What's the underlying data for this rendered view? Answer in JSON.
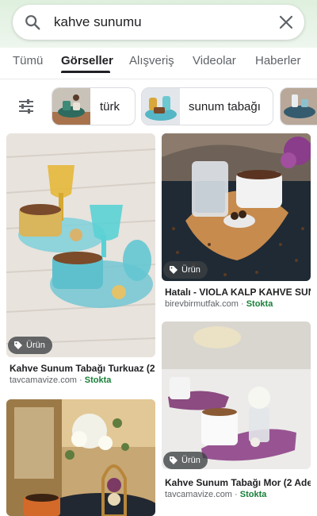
{
  "search": {
    "query": "kahve sunumu",
    "icons": {
      "search": "search-icon",
      "clear": "close-icon"
    }
  },
  "tabs": [
    {
      "label": "Tümü",
      "active": false
    },
    {
      "label": "Görseller",
      "active": true
    },
    {
      "label": "Alışveriş",
      "active": false
    },
    {
      "label": "Videolar",
      "active": false
    },
    {
      "label": "Haberler",
      "active": false
    }
  ],
  "chips": [
    {
      "label": "türk"
    },
    {
      "label": "sunum tabağı"
    }
  ],
  "results": [
    {
      "badge": "Ürün",
      "title": "Kahve Sunum Tabağı Turkuaz (2 ...",
      "source": "tavcamavize.com",
      "separator": " · ",
      "stock": "Stokta"
    },
    {
      "badge": "Ürün",
      "title": "Hatalı - VIOLA KALP KAHVE SUN...",
      "source": "birevbirmutfak.com",
      "separator": " · ",
      "stock": "Stokta"
    },
    {
      "badge": "Ürün",
      "title": "Kahve Sunum Tabağı Mor (2 Ade...",
      "source": "tavcamavize.com",
      "separator": " · ",
      "stock": "Stokta"
    }
  ],
  "colors": {
    "accent_green": "#188038",
    "header_tint": "#dff0de",
    "badge_bg": "#3c4043"
  }
}
